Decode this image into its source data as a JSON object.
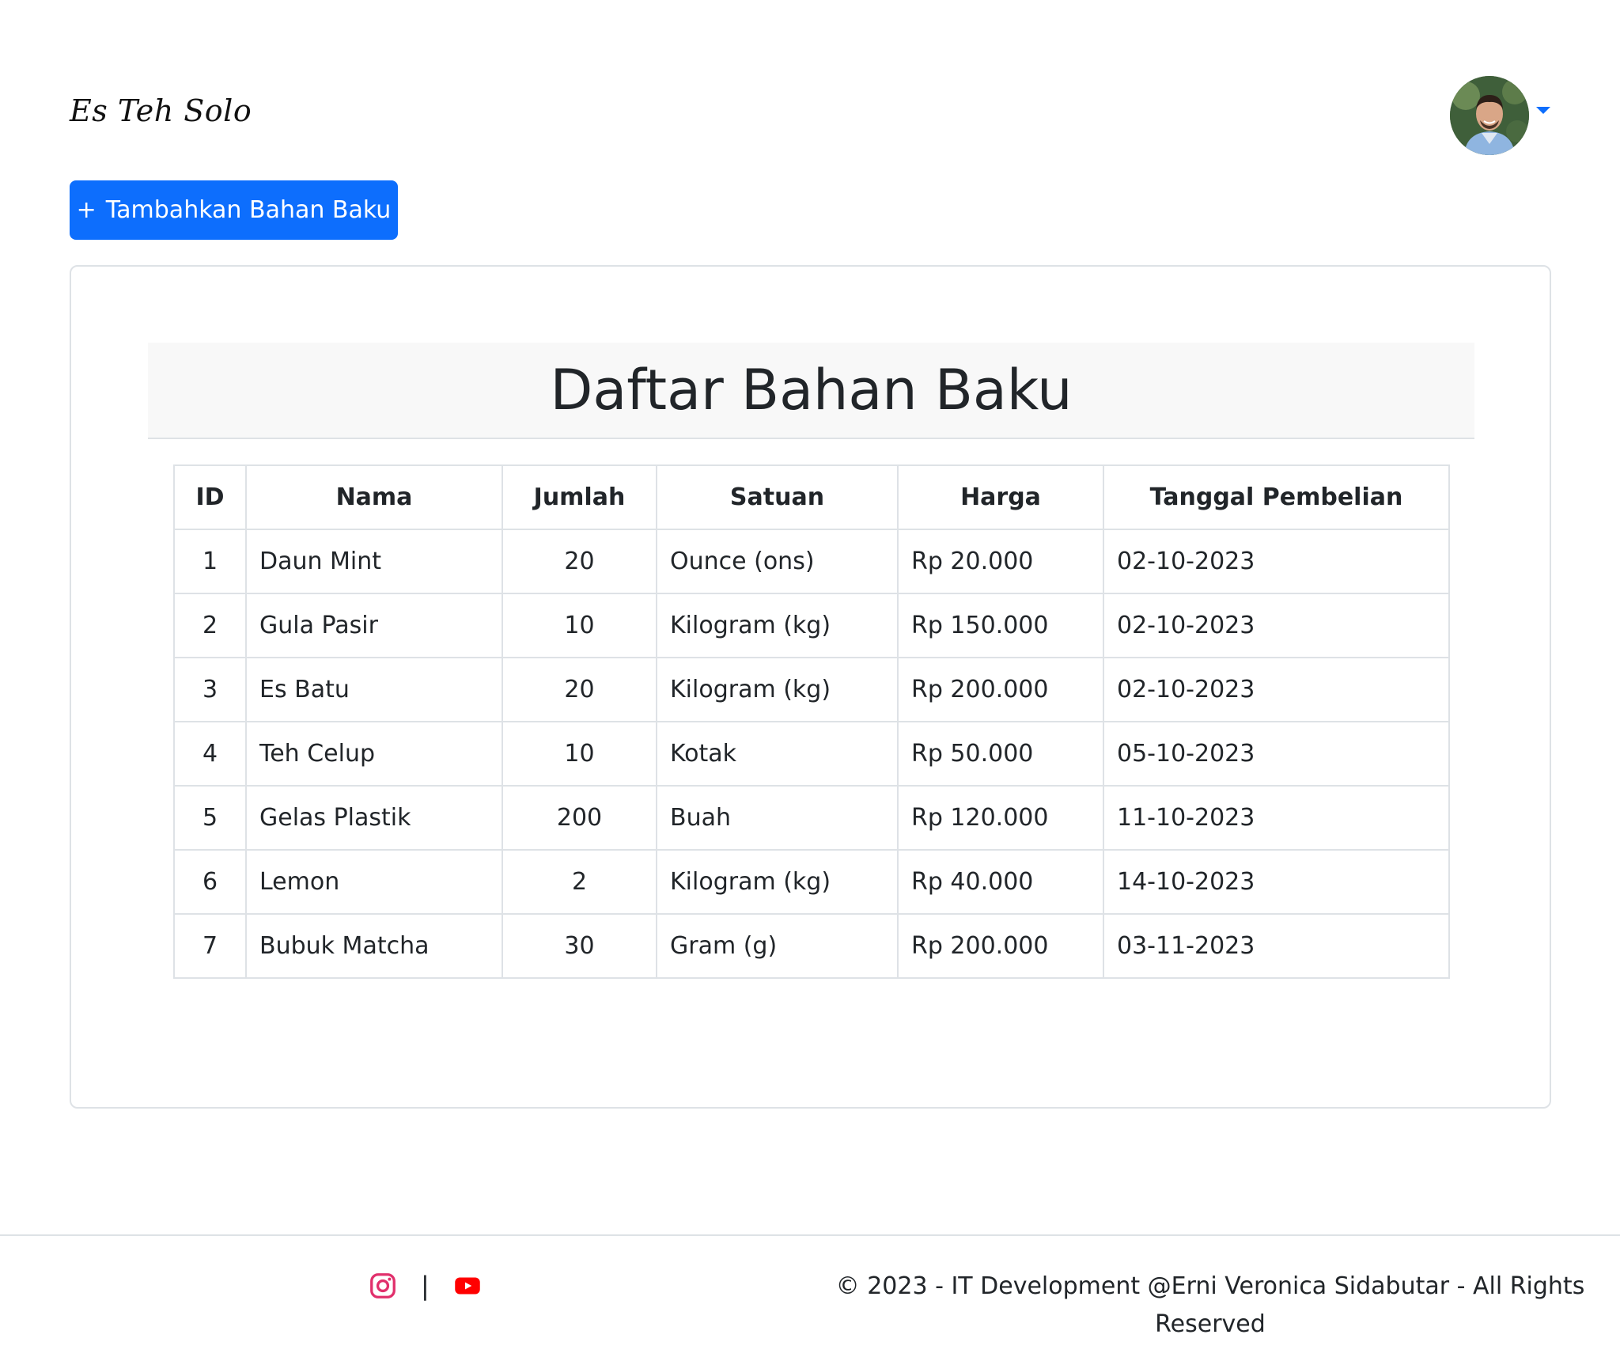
{
  "header": {
    "brand": "Es Teh Solo",
    "avatar_icon": "user-avatar",
    "dropdown_icon": "caret-down-icon"
  },
  "toolbar": {
    "add_icon": "+",
    "add_label": "Tambahkan Bahan Baku"
  },
  "card": {
    "title": "Daftar Bahan Baku"
  },
  "table": {
    "headers": [
      "ID",
      "Nama",
      "Jumlah",
      "Satuan",
      "Harga",
      "Tanggal Pembelian"
    ],
    "rows": [
      [
        "1",
        "Daun Mint",
        "20",
        "Ounce (ons)",
        "Rp 20.000",
        "02-10-2023"
      ],
      [
        "2",
        "Gula Pasir",
        "10",
        "Kilogram (kg)",
        "Rp 150.000",
        "02-10-2023"
      ],
      [
        "3",
        "Es Batu",
        "20",
        "Kilogram (kg)",
        "Rp 200.000",
        "02-10-2023"
      ],
      [
        "4",
        "Teh Celup",
        "10",
        "Kotak",
        "Rp 50.000",
        "05-10-2023"
      ],
      [
        "5",
        "Gelas Plastik",
        "200",
        "Buah",
        "Rp 120.000",
        "11-10-2023"
      ],
      [
        "6",
        "Lemon",
        "2",
        "Kilogram (kg)",
        "Rp 40.000",
        "14-10-2023"
      ],
      [
        "7",
        "Bubuk Matcha",
        "30",
        "Gram (g)",
        "Rp 200.000",
        "03-11-2023"
      ]
    ]
  },
  "footer": {
    "instagram_icon": "instagram-icon",
    "separator": "|",
    "youtube_icon": "youtube-icon",
    "copyright": "© 2023 - IT Development @Erni Veronica Sidabutar - All Rights Reserved"
  },
  "colors": {
    "primary": "#0d6efd",
    "instagram": "#e1306c",
    "youtube": "#ff0000",
    "border": "#dee2e6",
    "title_bar": "#f8f8f8"
  }
}
